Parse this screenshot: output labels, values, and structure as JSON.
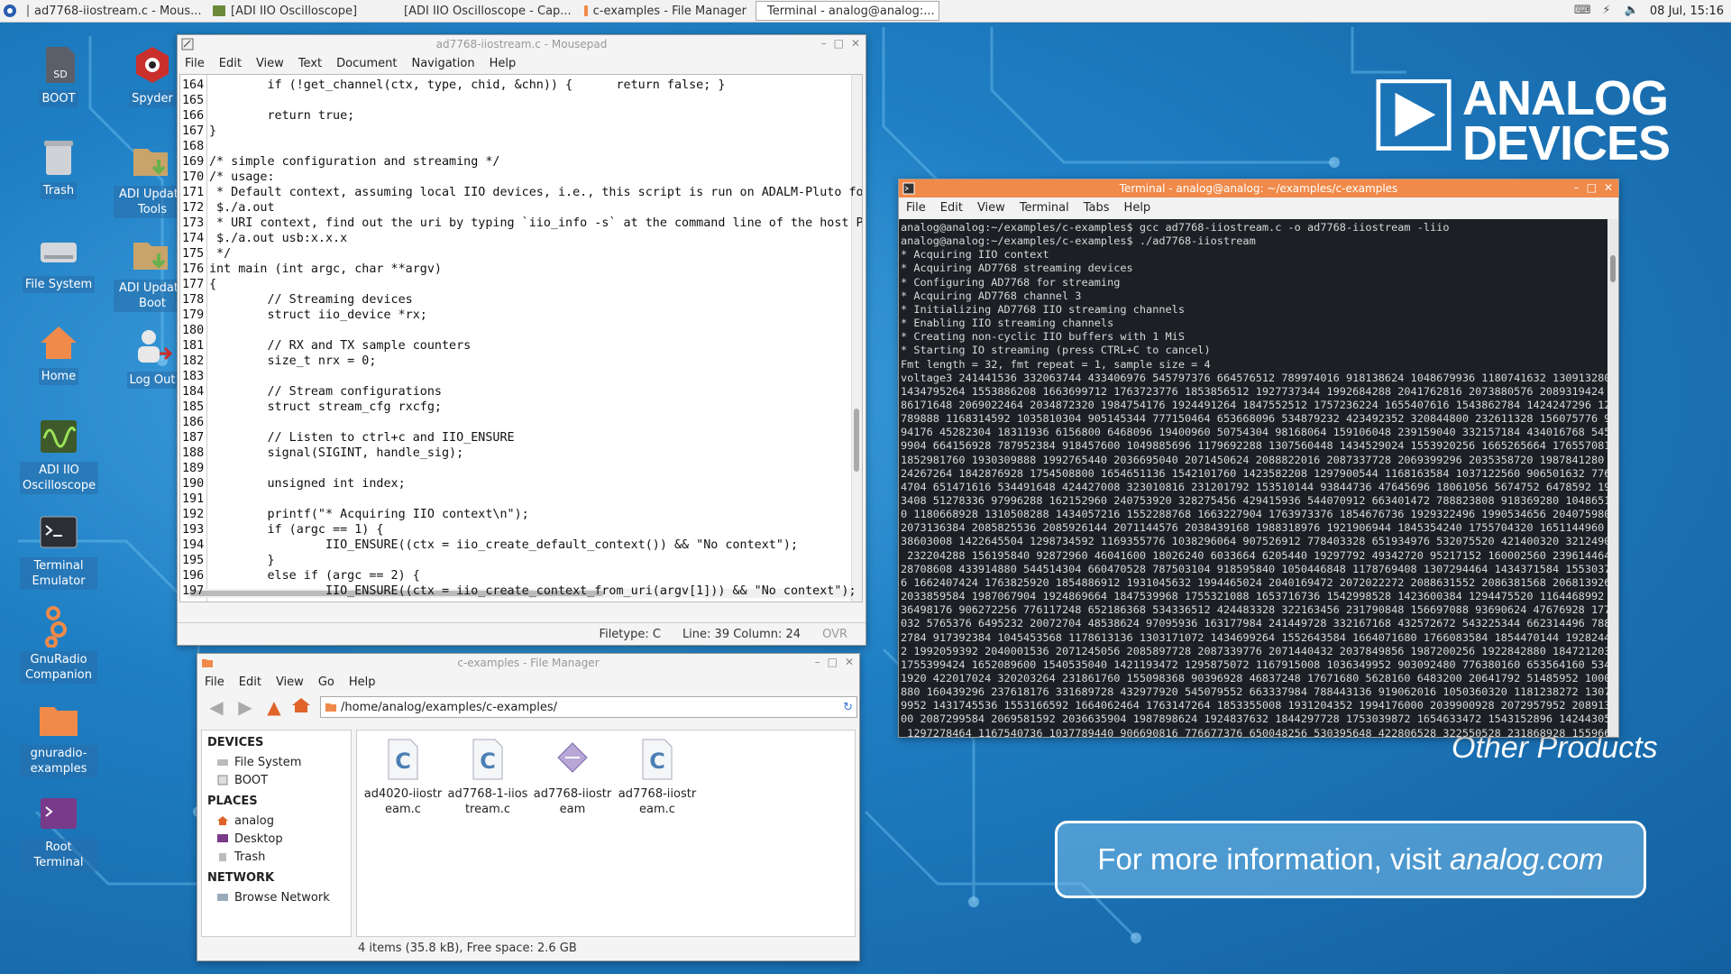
{
  "taskbar": {
    "tasks": [
      {
        "label": "ad7768-iiostream.c - Mous..."
      },
      {
        "label": "[ADI IIO Oscilloscope]"
      },
      {
        "label": "[ADI IIO Oscilloscope - Cap..."
      },
      {
        "label": "c-examples - File Manager"
      },
      {
        "label": "Terminal - analog@analog:..."
      }
    ],
    "clock": "08 Jul, 15:16"
  },
  "desktop_icons": [
    {
      "label": "BOOT",
      "icon": "sd-card-icon"
    },
    {
      "label": "Trash",
      "icon": "trash-icon"
    },
    {
      "label": "File System",
      "icon": "drive-icon"
    },
    {
      "label": "Home",
      "icon": "home-icon"
    },
    {
      "label": "ADI IIO Oscilloscope",
      "icon": "oscilloscope-icon"
    },
    {
      "label": "Terminal Emulator",
      "icon": "terminal-icon"
    },
    {
      "label": "GnuRadio Companion",
      "icon": "gnuradio-icon"
    },
    {
      "label": "gnuradio-examples",
      "icon": "folder-icon"
    },
    {
      "label": "Root Terminal",
      "icon": "root-terminal-icon"
    },
    {
      "label": "Spyder",
      "icon": "spyder-icon"
    },
    {
      "label": "ADI Update Tools",
      "icon": "update-icon"
    },
    {
      "label": "ADI Update Boot",
      "icon": "update-icon"
    },
    {
      "label": "Log Out",
      "icon": "logout-icon"
    }
  ],
  "mousepad": {
    "title": "ad7768-iiostream.c - Mousepad",
    "menu": [
      "File",
      "Edit",
      "View",
      "Text",
      "Document",
      "Navigation",
      "Help"
    ],
    "lines": [
      {
        "n": "164",
        "t": "        if (!get_channel(ctx, type, chid, &chn)) {      return false; }"
      },
      {
        "n": "165",
        "t": ""
      },
      {
        "n": "166",
        "t": "        return true;"
      },
      {
        "n": "167",
        "t": "}"
      },
      {
        "n": "168",
        "t": ""
      },
      {
        "n": "169",
        "t": "/* simple configuration and streaming */"
      },
      {
        "n": "170",
        "t": "/* usage:"
      },
      {
        "n": "171",
        "t": " * Default context, assuming local IIO devices, i.e., this script is run on ADALM-Pluto fo"
      },
      {
        "n": "172",
        "t": " $./a.out"
      },
      {
        "n": "173",
        "t": " * URI context, find out the uri by typing `iio_info -s` at the command line of the host P"
      },
      {
        "n": "174",
        "t": " $./a.out usb:x.x.x"
      },
      {
        "n": "175",
        "t": " */"
      },
      {
        "n": "176",
        "t": "int main (int argc, char **argv)"
      },
      {
        "n": "177",
        "t": "{"
      },
      {
        "n": "178",
        "t": "        // Streaming devices"
      },
      {
        "n": "179",
        "t": "        struct iio_device *rx;"
      },
      {
        "n": "180",
        "t": ""
      },
      {
        "n": "181",
        "t": "        // RX and TX sample counters"
      },
      {
        "n": "182",
        "t": "        size_t nrx = 0;"
      },
      {
        "n": "183",
        "t": ""
      },
      {
        "n": "184",
        "t": "        // Stream configurations"
      },
      {
        "n": "185",
        "t": "        struct stream_cfg rxcfg;"
      },
      {
        "n": "186",
        "t": ""
      },
      {
        "n": "187",
        "t": "        // Listen to ctrl+c and IIO_ENSURE"
      },
      {
        "n": "188",
        "t": "        signal(SIGINT, handle_sig);"
      },
      {
        "n": "189",
        "t": ""
      },
      {
        "n": "190",
        "t": "        unsigned int index;"
      },
      {
        "n": "191",
        "t": ""
      },
      {
        "n": "192",
        "t": "        printf(\"* Acquiring IIO context\\n\");"
      },
      {
        "n": "193",
        "t": "        if (argc == 1) {"
      },
      {
        "n": "194",
        "t": "                IIO_ENSURE((ctx = iio_create_default_context()) && \"No context\");"
      },
      {
        "n": "195",
        "t": "        }"
      },
      {
        "n": "196",
        "t": "        else if (argc == 2) {"
      },
      {
        "n": "197",
        "t": "                IIO_ENSURE((ctx = iio_create_context_from_uri(argv[1])) && \"No context\");"
      }
    ],
    "status": {
      "filetype": "Filetype: C",
      "position": "Line: 39 Column: 24",
      "mode": "OVR"
    }
  },
  "terminal": {
    "title": "Terminal - analog@analog: ~/examples/c-examples",
    "menu": [
      "File",
      "Edit",
      "View",
      "Terminal",
      "Tabs",
      "Help"
    ],
    "lines": [
      "analog@analog:~/examples/c-examples$ gcc ad7768-iiostream.c -o ad7768-iiostream -liio",
      "analog@analog:~/examples/c-examples$ ./ad7768-iiostream",
      "* Acquiring IIO context",
      "* Acquiring AD7768 streaming devices",
      "* Configuring AD7768 for streaming",
      "* Acquiring AD7768 channel 3",
      "* Initializing AD7768 IIO streaming channels",
      "* Enabling IIO streaming channels",
      "* Creating non-cyclic IIO buffers with 1 MiS",
      "* Starting IO streaming (press CTRL+C to cancel)",
      "Fmt length = 32, fmt repeat = 1, sample size = 4",
      "voltage3 241441536 332063744 433406976 545797376 664576512 789974016 918138624 1048679936 1180741632 1309132800",
      "1434795264 1553886208 1663699712 1763723776 1853856512 1927737344 1992684288 2041762816 2073880576 2089319424 20",
      "86171648 2069022464 2034872320 1984754176 1924491264 1847552512 1757236224 1655407616 1543862784 1424247296 1298",
      "789888 1168314592 1035810304 905145344 777150464 653668096 534879232 423492352 320844800 232611328 156075776 909",
      "94176 45282304 18311936 6156800 6468096 19400960 50754304 98168064 159106048 239159040 332157184 434016768 54517",
      "9904 664156928 787952384 918457600 1049885696 1179692288 1307560448 1434529024 1553920256 1665265664 1765570816",
      "1852981760 1930309888 1992765440 2036695040 2071450624 2088822016 2087337728 2069399296 2035358720 1987841280 19",
      "24267264 1842876928 1754508800 1654651136 1542101760 1423582208 1297900544 1168163584 1037122560 906501632 77690",
      "4704 651471616 534491648 424427008 323010816 231201792 153510144 93844736 47645696 18061056 5674752 6478592 1995",
      "3408 51278336 97996288 162152960 240753920 328275456 429415936 544070912 663401472 788823808 918369280 104865152",
      "0 1180668928 1310508288 1434057216 1552288768 1663227904 1763973376 1854676736 1929322496 1990534656 2040759808",
      "2073136384 2085825536 2085926144 2071144576 2038439168 1988318976 1921906944 1845354240 1755704320 1651144960 15",
      "38603008 1422645504 1298734592 1169355776 1038296064 907526912 778403328 651934976 532075520 421400320 321249024",
      " 232204288 156195840 92872960 46041600 18026240 6033664 6205440 19297792 49342720 95217152 160002560 239614464 3",
      "28708608 433914880 544514304 660470528 787503104 918595840 1050446848 1178769408 1307294464 1434371584 155303705",
      "6 1662407424 1763825920 1854886912 1931045632 1994465024 2040169472 2072022272 2088631552 2086381568 2068139264",
      "2033859584 1987067904 1924869664 1847539968 1755321088 1653716736 1542998528 1423600384 1294475520 1164468992 10",
      "36498176 906272256 776117248 652186368 534336512 424483328 322163456 231790848 156697088 93690624 47676928 17740",
      "032 5765376 6495232 20072704 48538624 97095936 163177984 241449728 332167168 432572672 543225344 662314496 78866",
      "2784 917392384 1045453568 1178613136 1303171072 1434699264 1552643584 1664071680 1766083584 1854470144 192824499",
      "2 1992059392 2040001536 2071245056 2085897728 2087339776 2071440432 2037849856 1987200256 1922842880 1847212032",
      "1755399424 1652089600 1540535040 1421193472 1295875072 1167915008 1036349952 903092480 776380160 653564160 53416",
      "1920 422017024 320203264 231861760 155098368 90396928 46837248 17671680 5628160 6483200 20641792 51485952 100058",
      "880 160439296 237618176 331689728 432977920 545079552 663337984 788443136 919062016 1050360320 1181238272 130738",
      "9952 1431745536 1553166592 1664062464 1763147264 1853355008 1931204352 1994176000 2039900928 2072957952 20891392",
      "00 2087299584 2069581592 2036635904 1987898624 1924837632 1844297728 1753039872 1654633472 1543152896 1424430592",
      " 1297278464 1167540736 1037789440 906690816 776677376 650048256 530395648 422806528 322550528 231868928 15596672"
    ]
  },
  "file_manager": {
    "title": "c-examples - File Manager",
    "menu": [
      "File",
      "Edit",
      "View",
      "Go",
      "Help"
    ],
    "path": "/home/analog/examples/c-examples/",
    "sections": [
      {
        "heading": "DEVICES",
        "items": [
          "File System",
          "BOOT"
        ]
      },
      {
        "heading": "PLACES",
        "items": [
          "analog",
          "Desktop",
          "Trash"
        ]
      },
      {
        "heading": "NETWORK",
        "items": [
          "Browse Network"
        ]
      }
    ],
    "files": [
      {
        "name": "ad4020-iiostream.c",
        "kind": "c-source"
      },
      {
        "name": "ad7768-1-iiostream.c",
        "kind": "c-source"
      },
      {
        "name": "ad7768-iiostream",
        "kind": "executable"
      },
      {
        "name": "ad7768-iiostream.c",
        "kind": "c-source"
      }
    ],
    "status": "4 items (35.8 kB), Free space: 2.6 GB"
  },
  "wallpaper": {
    "brand_line1": "ANALOG",
    "brand_line2": "DEVICES",
    "other_products": "Other Products",
    "info_prefix": "For more information, visit ",
    "info_link": "analog.com"
  },
  "colors": {
    "accent": "#1f76b9",
    "terminal_title": "#f08a4a",
    "terminal_bg": "#1c2025"
  }
}
